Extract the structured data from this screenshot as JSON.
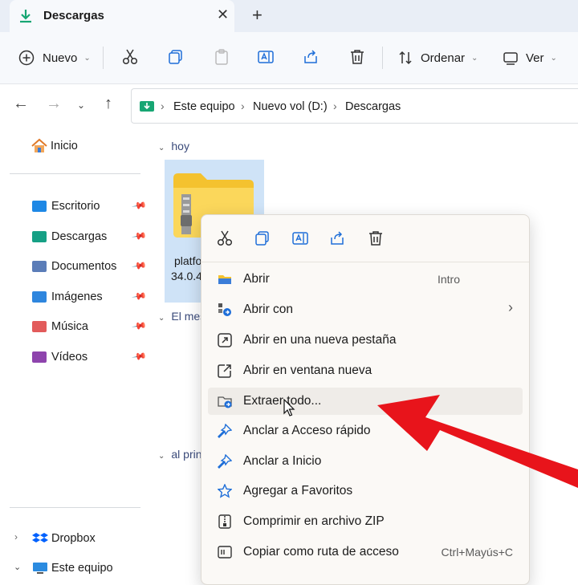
{
  "window": {
    "tab_title": "Descargas",
    "tab_close": "✕",
    "new_tab": "+"
  },
  "toolbar": {
    "new_label": "Nuevo",
    "sort_label": "Ordenar",
    "view_label": "Ver",
    "chevron": "⌄"
  },
  "address": {
    "crumbs": [
      "Este equipo",
      "Nuevo vol (D:)",
      "Descargas"
    ],
    "sep": "›"
  },
  "sidebar": {
    "home": "Inicio",
    "pinned": [
      {
        "label": "Escritorio",
        "color": "#1e88e5"
      },
      {
        "label": "Descargas",
        "color": "#16a085"
      },
      {
        "label": "Documentos",
        "color": "#5b7db8"
      },
      {
        "label": "Imágenes",
        "color": "#2e86de"
      },
      {
        "label": "Música",
        "color": "#e25b5b"
      },
      {
        "label": "Vídeos",
        "color": "#8e44ad"
      }
    ],
    "dropbox": "Dropbox",
    "this_pc": "Este equipo"
  },
  "content": {
    "group_today": "hoy",
    "group_month": "El mes",
    "group_early": "al prin",
    "file_line1": "platfo",
    "file_line2": "34.0.4"
  },
  "context_menu": {
    "items": [
      {
        "label": "Abrir",
        "shortcut": "Intro"
      },
      {
        "label": "Abrir con",
        "shortcut": "›"
      },
      {
        "label": "Abrir en una nueva pestaña",
        "shortcut": ""
      },
      {
        "label": "Abrir en ventana nueva",
        "shortcut": ""
      },
      {
        "label": "Extraer todo...",
        "shortcut": ""
      },
      {
        "label": "Anclar a Acceso rápido",
        "shortcut": ""
      },
      {
        "label": "Anclar a Inicio",
        "shortcut": ""
      },
      {
        "label": "Agregar a Favoritos",
        "shortcut": ""
      },
      {
        "label": "Comprimir en archivo ZIP",
        "shortcut": ""
      },
      {
        "label": "Copiar como ruta de acceso",
        "shortcut": "Ctrl+Mayús+C"
      }
    ]
  },
  "colors": {
    "accent_green": "#17a673",
    "pointer_arrow": "#e8141b",
    "selection": "#cfe3f7"
  }
}
